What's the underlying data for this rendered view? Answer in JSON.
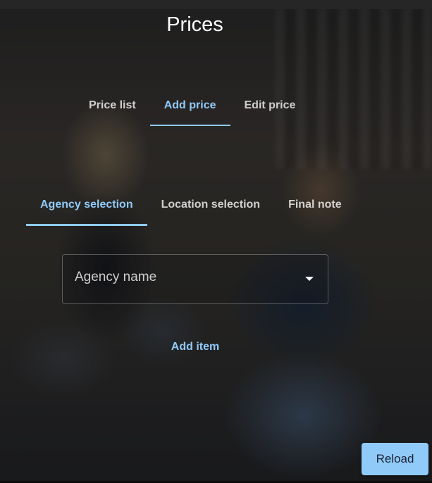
{
  "page": {
    "title": "Prices"
  },
  "primary_tabs": {
    "items": [
      {
        "label": "Price list",
        "active": false
      },
      {
        "label": "Add price",
        "active": true
      },
      {
        "label": "Edit price",
        "active": false
      }
    ]
  },
  "secondary_tabs": {
    "items": [
      {
        "label": "Agency selection",
        "active": true
      },
      {
        "label": "Location selection",
        "active": false
      },
      {
        "label": "Final note",
        "active": false
      }
    ]
  },
  "agency_select": {
    "label": "Agency name",
    "icon": "arrow-drop-down-icon"
  },
  "actions": {
    "add_item_label": "Add item",
    "reload_label": "Reload"
  },
  "colors": {
    "accent": "#90caf9",
    "title_text": "#ffffff",
    "inactive_tab_text": "#c7c7c7"
  }
}
